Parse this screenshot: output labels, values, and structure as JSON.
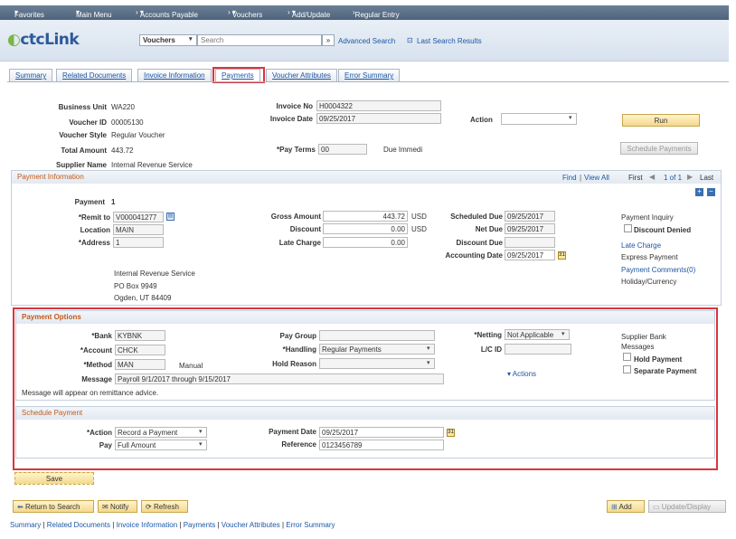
{
  "topbar": {
    "favorites": "Favorites",
    "main_menu": "Main Menu",
    "accounts_payable": "Accounts Payable",
    "vouchers": "Vouchers",
    "add_update": "Add/Update",
    "regular_entry": "Regular Entry"
  },
  "header": {
    "logo": "ctcLink",
    "search_type": "Vouchers",
    "search_placeholder": "Search",
    "advanced_search": "Advanced Search",
    "last_search": "Last Search Results"
  },
  "tabs": [
    "Summary",
    "Related Documents",
    "Invoice Information",
    "Payments",
    "Voucher Attributes",
    "Error Summary"
  ],
  "voucher": {
    "business_unit_label": "Business Unit",
    "business_unit": "WA220",
    "voucher_id_label": "Voucher ID",
    "voucher_id": "00005130",
    "voucher_style_label": "Voucher Style",
    "voucher_style": "Regular Voucher",
    "total_amount_label": "Total Amount",
    "total_amount": "443.72",
    "supplier_name_label": "Supplier Name",
    "supplier_name": "Internal Revenue Service",
    "invoice_no_label": "Invoice No",
    "invoice_no": "H0004322",
    "invoice_date_label": "Invoice Date",
    "invoice_date": "09/25/2017",
    "pay_terms_label": "*Pay Terms",
    "pay_terms": "00",
    "pay_terms_desc": "Due Immedi",
    "action_label": "Action",
    "run": "Run",
    "schedule_payments": "Schedule Payments"
  },
  "payment_info": {
    "title": "Payment Information",
    "find": "Find",
    "view_all": "View All",
    "first": "First",
    "count": "1 of 1",
    "last": "Last",
    "payment_label": "Payment",
    "payment_no": "1",
    "remit_label": "*Remit to",
    "remit": "V000041277",
    "location_label": "Location",
    "location": "MAIN",
    "address_label": "*Address",
    "address": "1",
    "address_lines": [
      "Internal Revenue Service",
      "PO Box 9949",
      "Ogden, UT  84409"
    ],
    "gross_label": "Gross Amount",
    "gross": "443.72",
    "usd1": "USD",
    "discount_label": "Discount",
    "discount": "0.00",
    "usd2": "USD",
    "late_label": "Late Charge",
    "late": "0.00",
    "sched_due_label": "Scheduled Due",
    "sched_due": "09/25/2017",
    "net_due_label": "Net Due",
    "net_due": "09/25/2017",
    "disc_due_label": "Discount Due",
    "disc_due": "",
    "acct_date_label": "Accounting Date",
    "acct_date": "09/25/2017",
    "right_links": {
      "payment_inquiry": "Payment Inquiry",
      "discount_denied": "Discount Denied",
      "late_charge": "Late Charge",
      "express_payment": "Express Payment",
      "payment_comments": "Payment Comments(0)",
      "holiday": "Holiday/Currency"
    }
  },
  "payment_options": {
    "title": "Payment Options",
    "bank_label": "*Bank",
    "bank": "KYBNK",
    "account_label": "*Account",
    "account": "CHCK",
    "method_label": "*Method",
    "method": "MAN",
    "method_desc": "Manual",
    "message_label": "Message",
    "message": "Payroll 9/1/2017 through 9/15/2017",
    "remittance_note": "Message will appear on remittance advice.",
    "pay_group_label": "Pay Group",
    "pay_group": "",
    "handling_label": "*Handling",
    "handling": "Regular Payments",
    "hold_reason_label": "Hold Reason",
    "hold_reason": "",
    "netting_label": "*Netting",
    "netting": "Not Applicable",
    "lc_id_label": "L/C ID",
    "lc_id": "",
    "actions": "Actions",
    "supplier_bank": "Supplier Bank",
    "messages": "Messages",
    "hold_payment": "Hold Payment",
    "separate_payment": "Separate Payment"
  },
  "schedule_payment": {
    "title": "Schedule Payment",
    "action_label": "*Action",
    "action": "Record a Payment",
    "pay_label": "Pay",
    "pay": "Full Amount",
    "payment_date_label": "Payment Date",
    "payment_date": "09/25/2017",
    "reference_label": "Reference",
    "reference": "0123456789"
  },
  "footer": {
    "save": "Save",
    "return_search": "Return to Search",
    "notify": "Notify",
    "refresh": "Refresh",
    "add": "Add",
    "update_display": "Update/Display",
    "links": [
      "Summary",
      "Related Documents",
      "Invoice Information",
      "Payments",
      "Voucher Attributes",
      "Error Summary"
    ]
  }
}
